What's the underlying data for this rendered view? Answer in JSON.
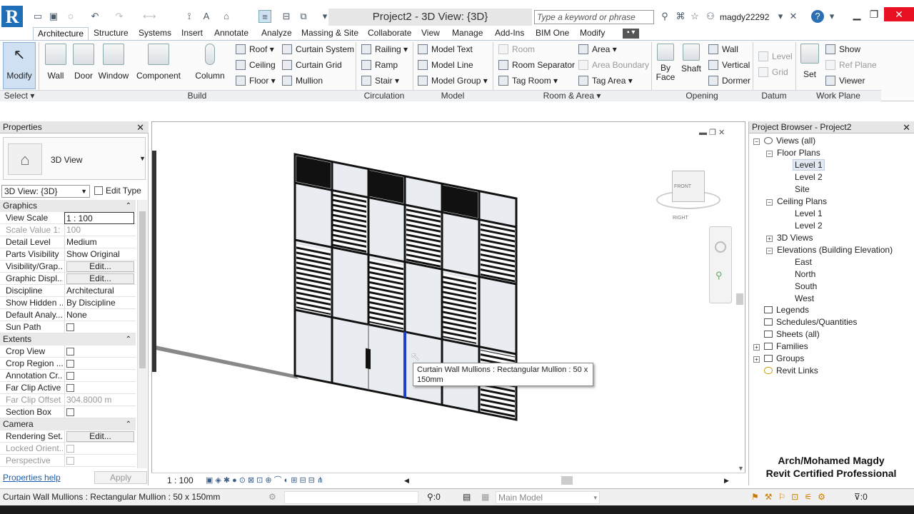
{
  "titlebar": {
    "app_letter": "R",
    "document_title": "Project2 - 3D View: {3D}",
    "search_placeholder": "Type a keyword or phrase",
    "username": "magdy22292"
  },
  "tabs": [
    "Architecture",
    "Structure",
    "Systems",
    "Insert",
    "Annotate",
    "Analyze",
    "Massing & Site",
    "Collaborate",
    "View",
    "Manage",
    "Add-Ins",
    "BIM One",
    "Modify"
  ],
  "active_tab": "Architecture",
  "ribbon": {
    "select": {
      "modify": "Modify",
      "label": "Select"
    },
    "build": {
      "label": "Build",
      "big": [
        "Wall",
        "Door",
        "Window",
        "Component",
        "Column"
      ],
      "small": [
        "Roof",
        "Ceiling",
        "Floor",
        "Curtain System",
        "Curtain Grid",
        "Mullion"
      ]
    },
    "circulation": {
      "label": "Circulation",
      "items": [
        "Railing",
        "Ramp",
        "Stair"
      ]
    },
    "model": {
      "label": "Model",
      "items": [
        "Model Text",
        "Model Line",
        "Model Group"
      ]
    },
    "room_area": {
      "label": "Room & Area",
      "items": [
        "Room",
        "Room Separator",
        "Tag Room",
        "Area",
        "Area Boundary",
        "Tag Area"
      ]
    },
    "opening": {
      "label": "Opening",
      "big": [
        "By Face",
        "Shaft"
      ],
      "small": [
        "Wall",
        "Vertical",
        "Dormer"
      ]
    },
    "datum": {
      "label": "Datum",
      "items": [
        "Level",
        "Grid"
      ]
    },
    "work_plane": {
      "label": "Work Plane",
      "big": "Set",
      "small": [
        "Show",
        "Ref Plane",
        "Viewer"
      ]
    }
  },
  "properties": {
    "title": "Properties",
    "type_name": "3D View",
    "view_selector": "3D View: {3D}",
    "edit_type": "Edit Type",
    "sections": {
      "graphics": "Graphics",
      "extents": "Extents",
      "camera": "Camera"
    },
    "graphics_rows": [
      {
        "k": "View Scale",
        "v": "1 : 100"
      },
      {
        "k": "Scale Value",
        "v": "100"
      },
      {
        "k": "Detail Level",
        "v": "Medium"
      },
      {
        "k": "Parts Visibility",
        "v": "Show Original"
      },
      {
        "k": "Visibility/Grap...",
        "v": "Edit..."
      },
      {
        "k": "Graphic Displ...",
        "v": "Edit..."
      },
      {
        "k": "Discipline",
        "v": "Architectural"
      },
      {
        "k": "Show Hidden ...",
        "v": "By Discipline"
      },
      {
        "k": "Default Analy...",
        "v": "None"
      },
      {
        "k": "Sun Path",
        "v": ""
      }
    ],
    "scale_prefix": "1:",
    "extents_rows": [
      {
        "k": "Crop View"
      },
      {
        "k": "Crop Region ..."
      },
      {
        "k": "Annotation Cr..."
      },
      {
        "k": "Far Clip Active"
      },
      {
        "k": "Far Clip Offset",
        "v": "304.8000 m"
      },
      {
        "k": "Section Box"
      }
    ],
    "camera_rows": [
      {
        "k": "Rendering Set...",
        "v": "Edit..."
      },
      {
        "k": "Locked Orient..."
      },
      {
        "k": "Perspective"
      }
    ],
    "help_link": "Properties help",
    "apply": "Apply"
  },
  "viewport": {
    "scale": "1 : 100",
    "tooltip": "Curtain Wall Mullions : Rectangular Mullion : 50 x 150mm",
    "viewcube_front": "FRONT",
    "viewcube_right": "RIGHT"
  },
  "browser": {
    "title": "Project Browser - Project2",
    "tree": [
      {
        "t": "Views (all)",
        "lvl": 0,
        "ex": "−"
      },
      {
        "t": "Floor Plans",
        "lvl": 1,
        "ex": "−"
      },
      {
        "t": "Level 1",
        "lvl": 2,
        "sel": true
      },
      {
        "t": "Level 2",
        "lvl": 2
      },
      {
        "t": "Site",
        "lvl": 2
      },
      {
        "t": "Ceiling Plans",
        "lvl": 1,
        "ex": "−"
      },
      {
        "t": "Level 1",
        "lvl": 2
      },
      {
        "t": "Level 2",
        "lvl": 2
      },
      {
        "t": "3D Views",
        "lvl": 1,
        "ex": "+"
      },
      {
        "t": "Elevations (Building Elevation)",
        "lvl": 1,
        "ex": "−"
      },
      {
        "t": "East",
        "lvl": 2
      },
      {
        "t": "North",
        "lvl": 2
      },
      {
        "t": "South",
        "lvl": 2
      },
      {
        "t": "West",
        "lvl": 2
      },
      {
        "t": "Legends",
        "lvl": 0
      },
      {
        "t": "Schedules/Quantities",
        "lvl": 0
      },
      {
        "t": "Sheets (all)",
        "lvl": 0
      },
      {
        "t": "Families",
        "lvl": 0,
        "ex": "+"
      },
      {
        "t": "Groups",
        "lvl": 0,
        "ex": "+"
      },
      {
        "t": "Revit Links",
        "lvl": 0
      }
    ]
  },
  "credit": {
    "line1": "Arch/Mohamed Magdy",
    "line2": "Revit Certified Professional"
  },
  "statusbar": {
    "message": "Curtain Wall Mullions : Rectangular Mullion : 50 x 150mm",
    "count": ":0",
    "model": "Main Model",
    "filter_count": ":0"
  },
  "colors": {
    "selection_blue": "#1f3fd0",
    "revit_blue": "#1e6fb8"
  }
}
